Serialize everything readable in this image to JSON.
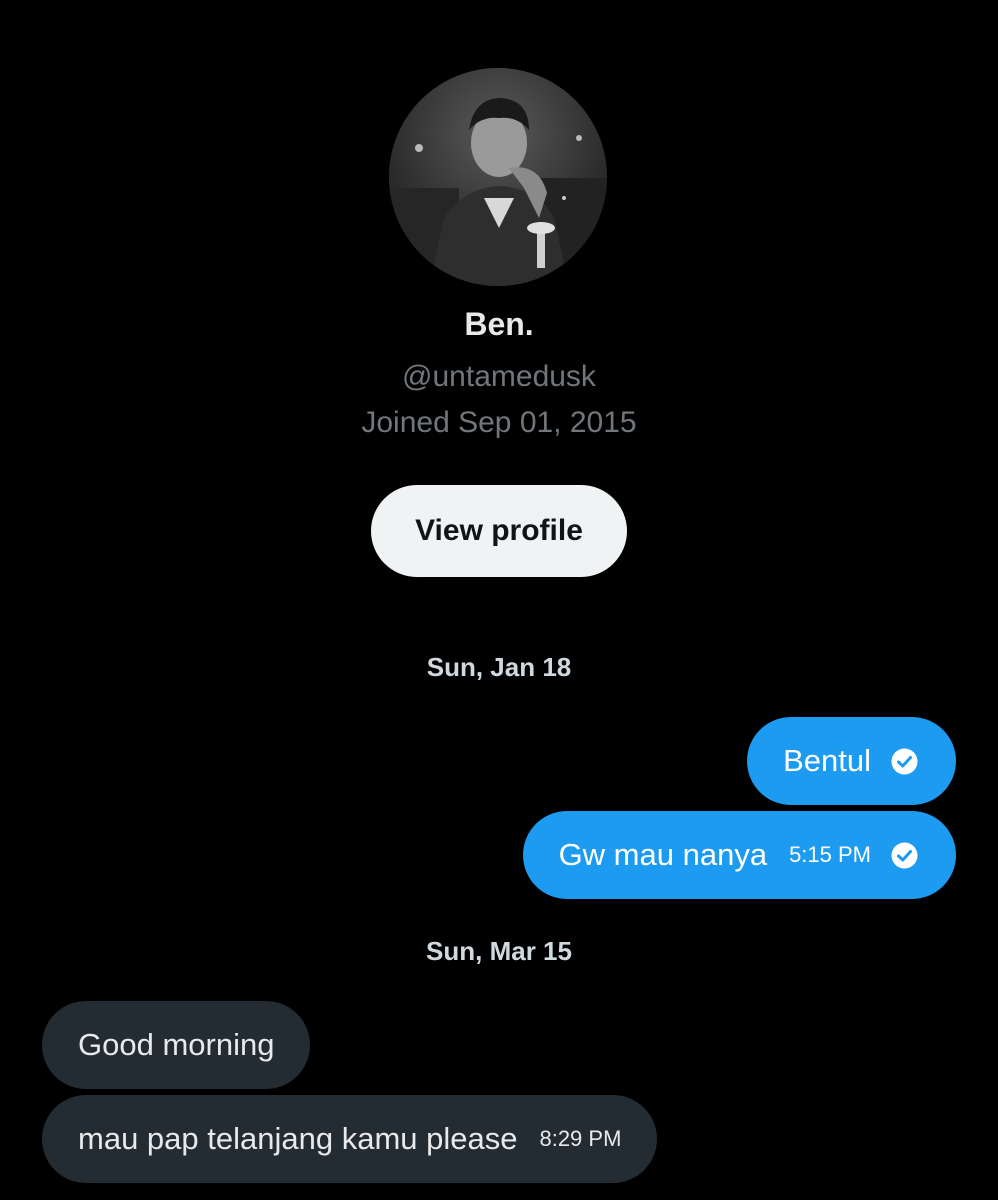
{
  "profile": {
    "name": "Ben.",
    "handle": "@untamedusk",
    "joined": "Joined Sep 01, 2015",
    "view_profile_label": "View profile"
  },
  "conversation": {
    "groups": [
      {
        "date": "Sun, Jan 18",
        "messages": [
          {
            "direction": "out",
            "text": "Bentul",
            "time": "",
            "status_icon": "read-check-icon"
          },
          {
            "direction": "out",
            "text": "Gw mau nanya",
            "time": "5:15 PM",
            "status_icon": "read-check-icon"
          }
        ]
      },
      {
        "date": "Sun, Mar 15",
        "messages": [
          {
            "direction": "in",
            "text": "Good morning",
            "time": ""
          },
          {
            "direction": "in",
            "text": "mau pap telanjang kamu please",
            "time": "8:29 PM"
          }
        ]
      }
    ]
  },
  "colors": {
    "background": "#000000",
    "outgoing_bubble": "#1d9bf0",
    "incoming_bubble": "#242c33",
    "button": "#eff3f4",
    "secondary_text": "#71767b"
  }
}
